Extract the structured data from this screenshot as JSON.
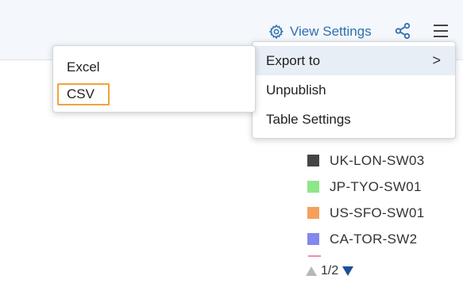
{
  "header": {
    "view_settings_label": "View Settings",
    "icons": [
      "gear-icon",
      "share-icon",
      "hamburger-menu-icon"
    ],
    "accent_color": "#2f6fb0"
  },
  "menu": {
    "items": [
      {
        "label": "Export to",
        "has_submenu": true,
        "active": true
      },
      {
        "label": "Unpublish"
      },
      {
        "label": "Table Settings"
      }
    ],
    "chevron": ">"
  },
  "export_submenu": {
    "items": [
      {
        "label": "Excel"
      },
      {
        "label": "CSV",
        "highlighted": true
      }
    ],
    "highlight_color": "#f0a33a"
  },
  "legend": {
    "items": [
      {
        "label": "UK-LON-SW03",
        "color": "#444444"
      },
      {
        "label": "JP-TYO-SW01",
        "color": "#8ee68a"
      },
      {
        "label": "US-SFO-SW01",
        "color": "#f5a05a"
      },
      {
        "label": "CA-TOR-SW2",
        "color": "#8288ee"
      }
    ],
    "page_indicator": "1/2"
  }
}
